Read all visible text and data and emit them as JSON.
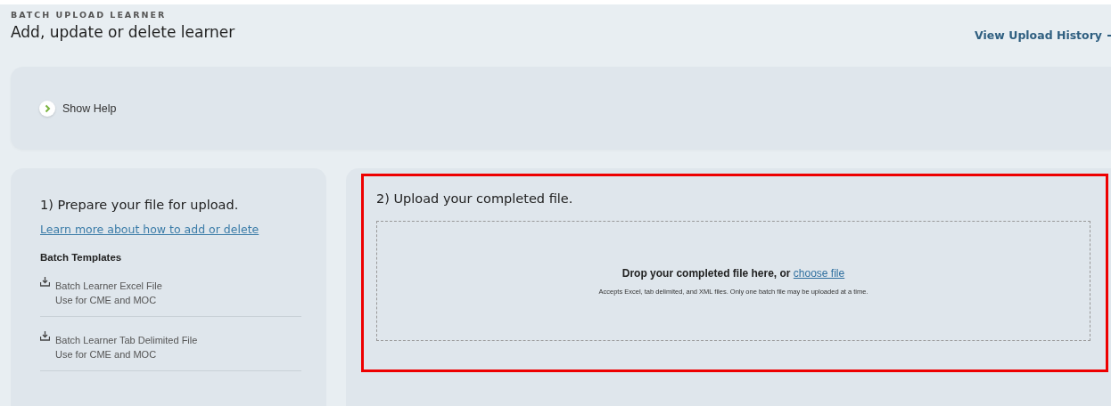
{
  "header": {
    "eyebrow": "BATCH UPLOAD LEARNER",
    "title": "Add, update or delete learner",
    "history_link": "View Upload History"
  },
  "help": {
    "label": "Show Help",
    "expanded": false
  },
  "prepare": {
    "heading": "1) Prepare your file for upload.",
    "link": "Learn more about how to add or delete",
    "templates_heading": "Batch Templates",
    "templates": [
      {
        "name": "Batch Learner Excel File",
        "note": "Use for CME and MOC"
      },
      {
        "name": "Batch Learner Tab Delimited File",
        "note": "Use for CME and MOC"
      }
    ]
  },
  "upload": {
    "heading": "2) Upload your completed file.",
    "highlighted": true,
    "drop_text": "Drop your completed file here, or",
    "choose_link": "choose file",
    "hint": "Accepts Excel, tab delimited, and XML files. Only one batch file may be uploaded at a time."
  }
}
